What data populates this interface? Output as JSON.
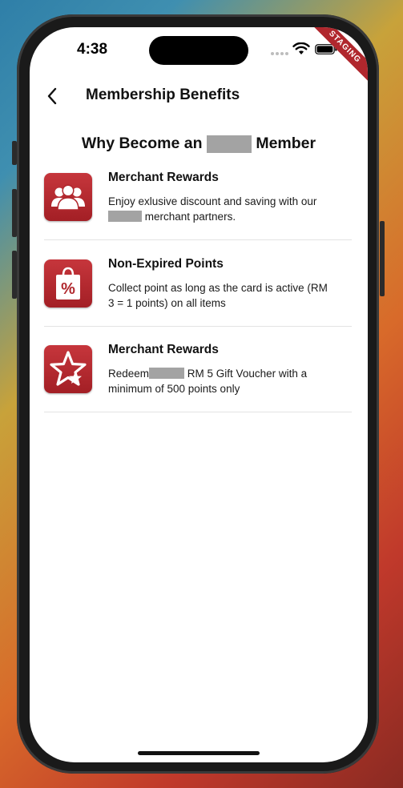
{
  "status_bar": {
    "time": "4:38",
    "staging_label": "STAGING"
  },
  "nav": {
    "title": "Membership Benefits"
  },
  "headline": {
    "prefix": "Why Become an",
    "suffix": "Member"
  },
  "benefits": [
    {
      "icon": "group-people-icon",
      "title": "Merchant Rewards",
      "desc_line1": "Enjoy exlusive discount and saving with our",
      "desc_line2": "merchant partners."
    },
    {
      "icon": "shopping-bag-percent-icon",
      "title": "Non-Expired Points",
      "desc_line1": "Collect point as long as the card is active (RM",
      "desc_line2": "3 = 1 points) on all items"
    },
    {
      "icon": "star-icon",
      "title": "Merchant Rewards",
      "desc_prefix": "Redeem",
      "desc_after_redact": "RM 5 Gift Voucher with a",
      "desc_line2": "minimum of 500 points only"
    }
  ],
  "colors": {
    "icon_red": "#b0272d",
    "redaction_gray": "#a3a3a3"
  }
}
